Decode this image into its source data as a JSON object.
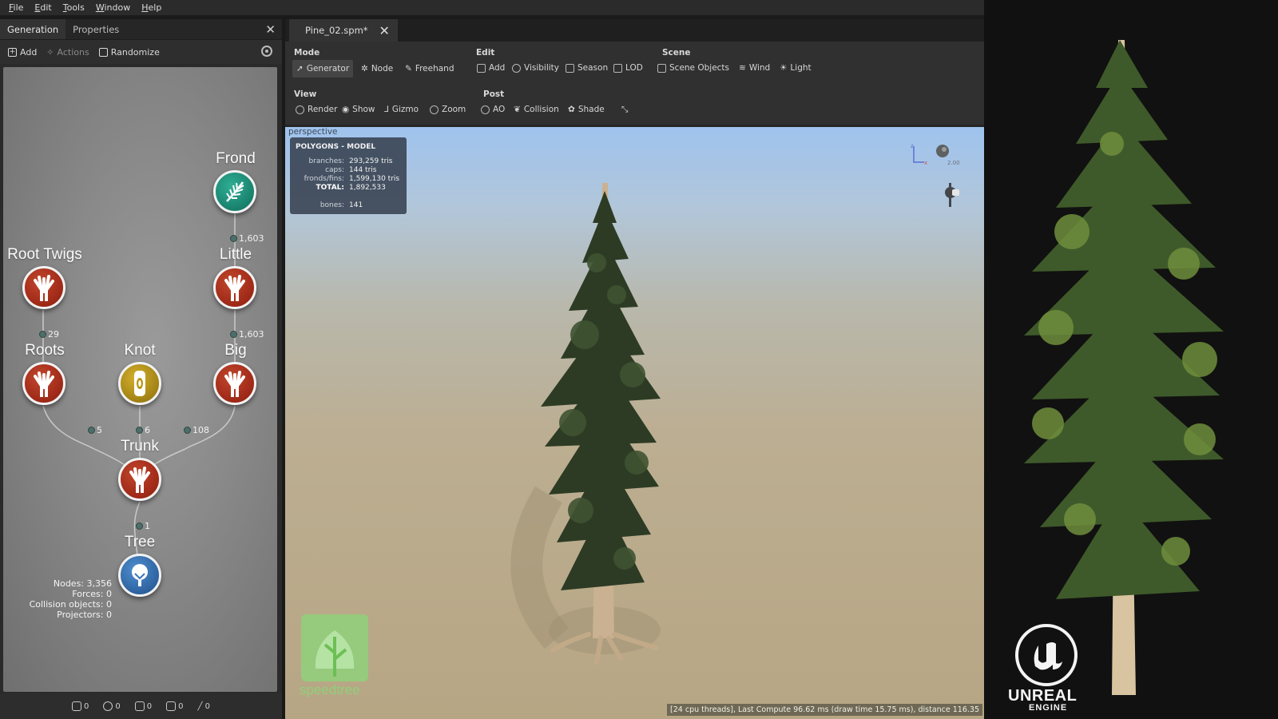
{
  "menu": [
    "File",
    "Edit",
    "Tools",
    "Window",
    "Help"
  ],
  "left_panel": {
    "tabs": [
      "Generation",
      "Properties"
    ],
    "toolbar": {
      "add": "Add",
      "actions": "Actions",
      "randomize": "Randomize"
    },
    "nodes": {
      "frond": "Frond",
      "little": "Little",
      "big": "Big",
      "root_twigs": "Root Twigs",
      "roots": "Roots",
      "knot": "Knot",
      "trunk": "Trunk",
      "tree": "Tree"
    },
    "counts": {
      "frond": "1,603",
      "little": "1,603",
      "big": "108",
      "root_twigs": "29",
      "roots": "5",
      "knot": "6",
      "trunk": "1"
    },
    "stats": {
      "nodes": "Nodes: 3,356",
      "forces": "Forces: 0",
      "collision": "Collision objects: 0",
      "projectors": "Projectors: 0"
    },
    "bottom_counts": [
      "0",
      "0",
      "0",
      "0",
      "0"
    ]
  },
  "document": {
    "tab": "Pine_02.spm*"
  },
  "ribbon": {
    "mode_label": "Mode",
    "mode": {
      "generator": "Generator",
      "node": "Node",
      "freehand": "Freehand"
    },
    "edit_label": "Edit",
    "edit": {
      "add": "Add",
      "visibility": "Visibility",
      "season": "Season",
      "lod": "LOD"
    },
    "scene_label": "Scene",
    "scene": {
      "objects": "Scene Objects",
      "wind": "Wind",
      "light": "Light"
    },
    "view_label": "View",
    "view": {
      "render": "Render",
      "show": "Show",
      "gizmo": "Gizmo",
      "zoom": "Zoom"
    },
    "post_label": "Post",
    "post": {
      "ao": "AO",
      "collision": "Collision",
      "shade": "Shade"
    }
  },
  "viewport": {
    "label": "perspective",
    "polygons": {
      "header": "POLYGONS - MODEL",
      "branches_k": "branches:",
      "branches_v": "293,259 tris",
      "caps_k": "caps:",
      "caps_v": "144 tris",
      "fronds_k": "fronds/fins:",
      "fronds_v": "1,599,130 tris",
      "total_k": "TOTAL:",
      "total_v": "1,892,533",
      "bones_k": "bones:",
      "bones_v": "141"
    },
    "gizmo_value": "2.00",
    "status": "[24 cpu threads], Last Compute 96.62 ms (draw time 15.75 ms), distance 116.35",
    "watermark": "speedtree"
  },
  "right_panel": {
    "brand_line1": "UNREAL",
    "brand_line2": "ENGINE"
  },
  "colors": {
    "frond_node": "#1f8d78",
    "branch_node": "#a8321c",
    "knot_node": "#b8950e",
    "tree_node": "#3a74b8"
  }
}
